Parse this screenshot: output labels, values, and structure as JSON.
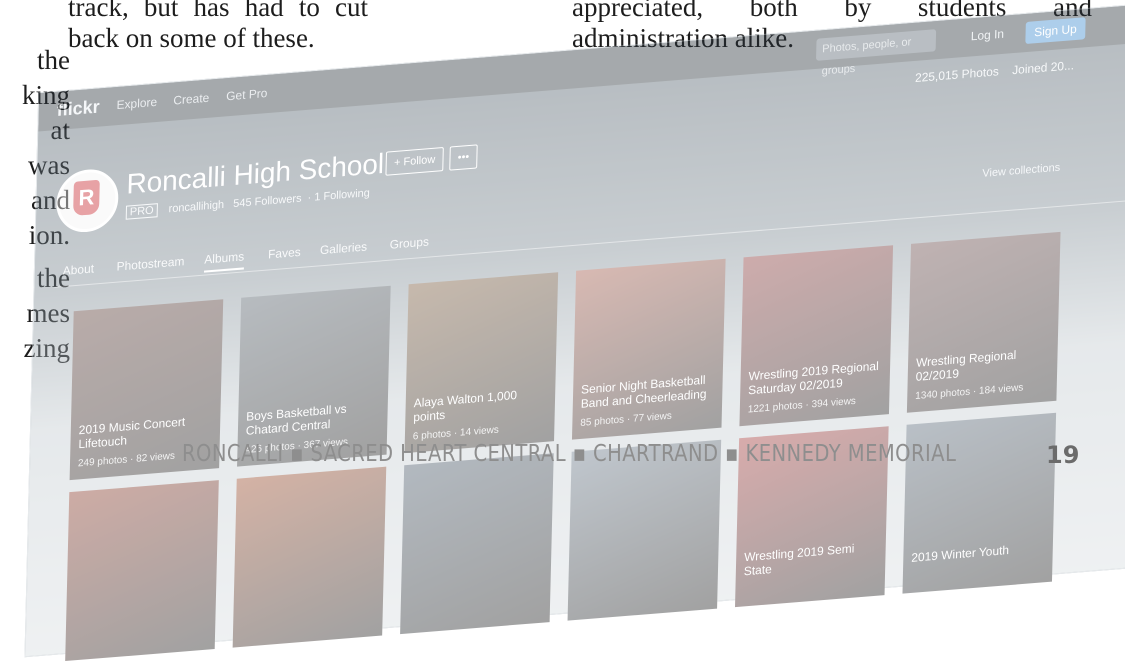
{
  "body_text": {
    "left_fragments": [
      "the",
      "king",
      "at",
      "was",
      "and",
      "ion.",
      "the",
      "mes",
      "zing"
    ],
    "paragraph_1": "track, but has had to cut back on some of these.",
    "paragraph_2": "appreciated, both by students and administration alike."
  },
  "screenshot": {
    "brand": "flickr",
    "nav": [
      "Explore",
      "Create",
      "Get Pro"
    ],
    "search_placeholder": "Photos, people, or groups",
    "login": "Log In",
    "signup": "Sign Up",
    "profile": {
      "name": "Roncalli High School",
      "follow": "+ Follow",
      "more": "•••",
      "pro": "PRO",
      "username": "roncallihigh",
      "followers": "545 Followers",
      "following": "1 Following"
    },
    "stats": {
      "photos": "225,015 Photos",
      "joined": "Joined 20..."
    },
    "view_more": "View collections",
    "tabs": [
      "About",
      "Photostream",
      "Albums",
      "Faves",
      "Galleries",
      "Groups"
    ],
    "active_tab": "Albums",
    "albums": [
      {
        "title": "2019 Music Concert Lifetouch",
        "count": "249 photos · 82 views",
        "color": "#5a3a34"
      },
      {
        "title": "Boys Basketball vs Chatard Central",
        "count": "426 photos · 367 views",
        "color": "#55606a"
      },
      {
        "title": "Alaya Walton 1,000 points",
        "count": "6 photos · 14 views",
        "color": "#7a5a3c"
      },
      {
        "title": "Senior Night Basketball Band and Cheerleading",
        "count": "85 photos · 77 views",
        "color": "#a35a4a"
      },
      {
        "title": "Wrestling 2019 Regional Saturday 02/2019",
        "count": "1221 photos · 394 views",
        "color": "#8b3a3a"
      },
      {
        "title": "Wrestling Regional 02/2019",
        "count": "1340 photos · 184 views",
        "color": "#6a4a4a"
      }
    ],
    "albums_row2": [
      {
        "title": "",
        "color": "#8a3a2a"
      },
      {
        "title": "",
        "color": "#9a4a2a"
      },
      {
        "title": "",
        "color": "#4a5a6a"
      },
      {
        "title": "",
        "color": "#6a7a8a"
      },
      {
        "title": "Wrestling 2019 Semi State",
        "color": "#a33a3a"
      },
      {
        "title": "2019 Winter Youth",
        "color": "#5a6a7a"
      }
    ]
  },
  "footer": {
    "schools": "RONCALLI ▪ SACRED HEART CENTRAL ▪ CHARTRAND ▪ KENNEDY MEMORIAL",
    "page_number": "19"
  }
}
